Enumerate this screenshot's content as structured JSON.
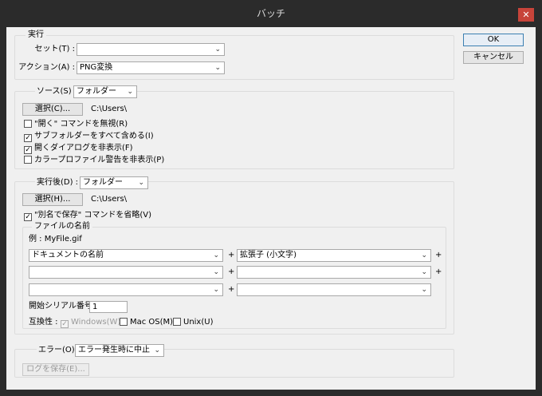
{
  "window": {
    "title": "バッチ",
    "close_glyph": "✕"
  },
  "buttons": {
    "ok": "OK",
    "cancel": "キャンセル"
  },
  "execute": {
    "legend": "実行",
    "set_label": "セット(T) :",
    "set_value": "",
    "action_label": "アクション(A) :",
    "action_value": "PNG変換"
  },
  "source": {
    "label": "ソース(S) :",
    "value": "フォルダー",
    "choose_label": "選択(C)...",
    "path": "C:\\Users\\",
    "checkboxes": [
      {
        "label": "\"開く\" コマンドを無視(R)",
        "checked": false
      },
      {
        "label": "サブフォルダーをすべて含める(I)",
        "checked": true
      },
      {
        "label": "開くダイアログを非表示(F)",
        "checked": true
      },
      {
        "label": "カラープロファイル警告を非表示(P)",
        "checked": false
      }
    ]
  },
  "destination": {
    "label": "実行後(D) :",
    "value": "フォルダー",
    "choose_label": "選択(H)...",
    "path": "C:\\Users\\",
    "override_save_as": {
      "label": "\"別名で保存\" コマンドを省略(V)",
      "checked": true
    },
    "file_naming": {
      "legend": "ファイルの名前",
      "example": "例 : MyFile.gif",
      "plus": "+",
      "rows": [
        {
          "left": "ドキュメントの名前",
          "right": "拡張子 (小文字)"
        },
        {
          "left": "",
          "right": ""
        },
        {
          "left": "",
          "right": ""
        }
      ],
      "serial_label": "開始シリアル番号 :",
      "serial_value": "1",
      "compat_label": "互換性 :",
      "compat": [
        {
          "label": "Windows(W)",
          "checked": true,
          "disabled": true
        },
        {
          "label": "Mac OS(M)",
          "checked": false,
          "disabled": false
        },
        {
          "label": "Unix(U)",
          "checked": false,
          "disabled": false
        }
      ]
    }
  },
  "errors": {
    "label": "エラー(O) :",
    "value": "エラー発生時に中止",
    "save_log_label": "ログを保存(E)..."
  },
  "icons": {
    "dropdown": "chevron-down-icon",
    "checkmark": "checkmark-icon"
  }
}
